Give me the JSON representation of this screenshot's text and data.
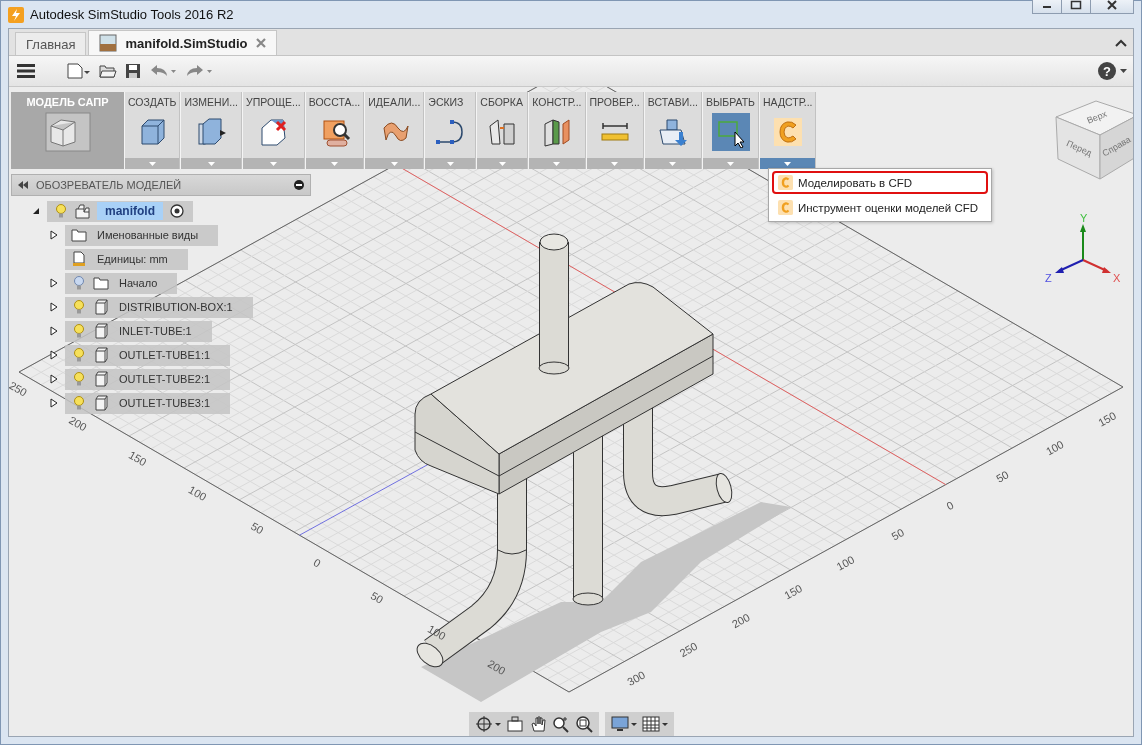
{
  "window": {
    "title": "Autodesk SimStudio Tools 2016 R2"
  },
  "tabs": [
    {
      "label": "Главная",
      "selected": false,
      "closable": false
    },
    {
      "label": "manifold.SimStudio",
      "selected": true,
      "closable": true
    }
  ],
  "toolbar": {
    "help": "?"
  },
  "workspace": {
    "label": "МОДЕЛЬ САПР"
  },
  "ribbon": [
    {
      "label": "СОЗДАТЬ",
      "kind": "create",
      "selected": false,
      "open": false
    },
    {
      "label": "ИЗМЕНИ...",
      "kind": "modify",
      "selected": false,
      "open": false
    },
    {
      "label": "УПРОЩЕ...",
      "kind": "simplify",
      "selected": false,
      "open": false
    },
    {
      "label": "ВОССТА...",
      "kind": "restore",
      "selected": false,
      "open": false
    },
    {
      "label": "ИДЕАЛИ...",
      "kind": "idealize",
      "selected": false,
      "open": false
    },
    {
      "label": "ЭСКИЗ",
      "kind": "sketch",
      "selected": false,
      "open": false
    },
    {
      "label": "СБОРКА",
      "kind": "assemble",
      "selected": false,
      "open": false
    },
    {
      "label": "КОНСТР...",
      "kind": "construct",
      "selected": false,
      "open": false
    },
    {
      "label": "ПРОВЕР...",
      "kind": "inspect",
      "selected": false,
      "open": false
    },
    {
      "label": "ВСТАВИ...",
      "kind": "insert",
      "selected": false,
      "open": false
    },
    {
      "label": "ВЫБРАТЬ",
      "kind": "select",
      "selected": true,
      "open": false
    },
    {
      "label": "НАДСТР...",
      "kind": "addin",
      "selected": false,
      "open": true
    }
  ],
  "addin_menu": [
    {
      "label": "Моделировать в CFD",
      "outlined": true
    },
    {
      "label": "Инструмент оценки моделей CFD",
      "outlined": false
    }
  ],
  "browser": {
    "title": "ОБОЗРЕВАТЕЛЬ МОДЕЛЕЙ",
    "root": {
      "label": "manifold",
      "kind": "assembly",
      "visible": true,
      "expanded": true,
      "selected": true,
      "children": [
        {
          "label": "Именованные виды",
          "kind": "folder",
          "expanded": false
        },
        {
          "label": "Единицы: mm",
          "kind": "units"
        },
        {
          "label": "Начало",
          "kind": "folder",
          "visible": false,
          "expanded": false
        },
        {
          "label": "DISTRIBUTION-BOX:1",
          "kind": "component",
          "visible": true,
          "expanded": false
        },
        {
          "label": "INLET-TUBE:1",
          "kind": "component",
          "visible": true,
          "expanded": false
        },
        {
          "label": "OUTLET-TUBE1:1",
          "kind": "component",
          "visible": true,
          "expanded": false
        },
        {
          "label": "OUTLET-TUBE2:1",
          "kind": "component",
          "visible": true,
          "expanded": false
        },
        {
          "label": "OUTLET-TUBE3:1",
          "kind": "component",
          "visible": true,
          "expanded": false
        }
      ]
    }
  },
  "grid": {
    "left_labels": [
      "250",
      "200",
      "150",
      "100",
      "50",
      "0",
      "50",
      "100",
      "200"
    ],
    "right_labels": [
      "300",
      "250",
      "200",
      "150",
      "100",
      "50",
      "0",
      "50",
      "100",
      "150"
    ]
  },
  "view_cube": {
    "top": "Верх",
    "front": "Перед",
    "right": "Справа"
  },
  "triad": {
    "x": "X",
    "y": "Y",
    "z": "Z"
  }
}
